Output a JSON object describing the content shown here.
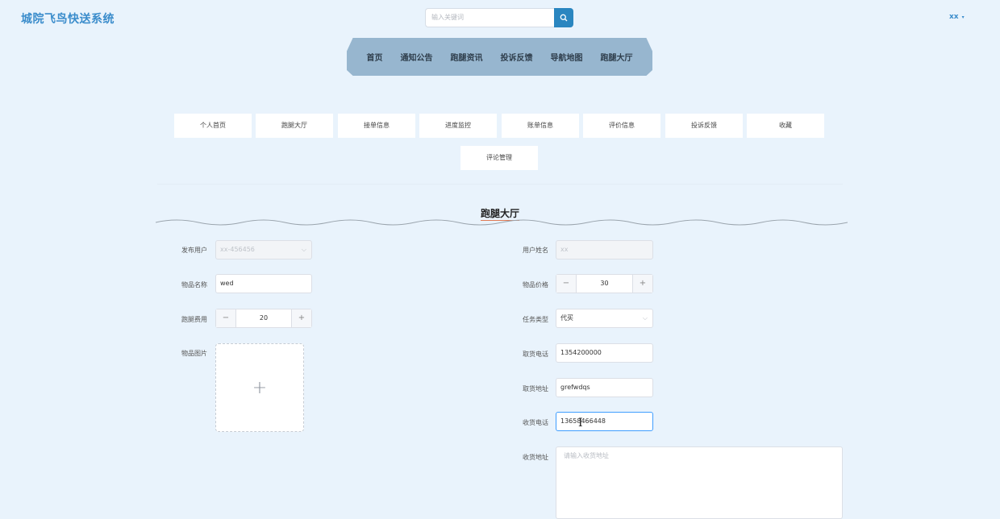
{
  "app": {
    "title": "城院飞鸟快送系统"
  },
  "search": {
    "placeholder": "输入关键词"
  },
  "user": {
    "name": "xx",
    "caret": "▾"
  },
  "topnav": [
    "首页",
    "通知公告",
    "跑腿资讯",
    "投诉反馈",
    "导航地图",
    "跑腿大厅"
  ],
  "subnav": [
    "个人首页",
    "跑腿大厅",
    "接单信息",
    "进度监控",
    "账单信息",
    "评价信息",
    "投诉反馈",
    "收藏",
    "评论管理"
  ],
  "section_title": "跑腿大厅",
  "form": {
    "publish_user": {
      "label": "发布用户",
      "value": "xx-456456"
    },
    "user_name": {
      "label": "用户姓名",
      "value": "xx"
    },
    "item_name": {
      "label": "物品名称",
      "value": "wed"
    },
    "item_price": {
      "label": "物品价格",
      "value": "30"
    },
    "errand_fee": {
      "label": "跑腿费用",
      "value": "20"
    },
    "task_type": {
      "label": "任务类型",
      "value": "代买"
    },
    "item_image": {
      "label": "物品图片"
    },
    "pickup_phone": {
      "label": "取货电话",
      "value": "1354200000"
    },
    "pickup_address": {
      "label": "取货地址",
      "value": "grefwdqs"
    },
    "delivery_phone": {
      "label": "收货电话",
      "value": "13658466448"
    },
    "delivery_address": {
      "label": "收货地址",
      "placeholder": "请输入收货地址"
    }
  },
  "icons": {
    "stepper_minus": "−",
    "stepper_plus": "+",
    "upload_plus": "+",
    "select_chevron": "⌵"
  }
}
